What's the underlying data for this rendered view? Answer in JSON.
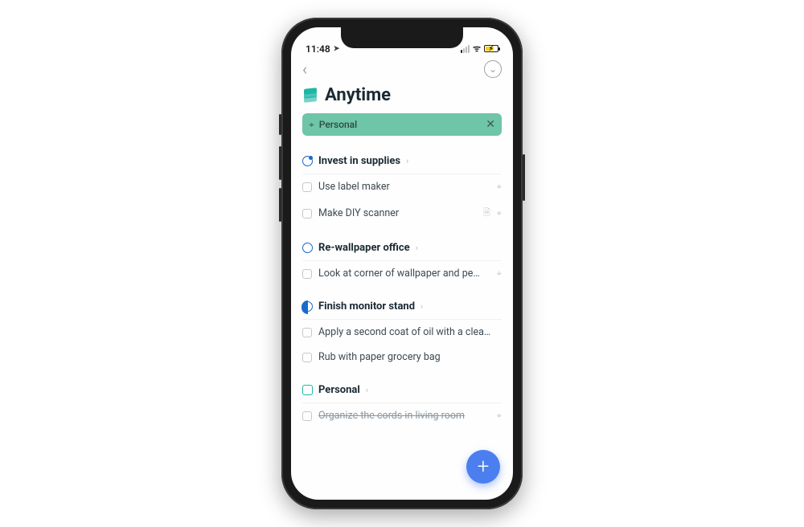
{
  "statusbar": {
    "time": "11:48"
  },
  "page": {
    "title": "Anytime"
  },
  "filter": {
    "label": "Personal"
  },
  "sections": [
    {
      "id": "invest",
      "title": "Invest in supplies",
      "tasks": [
        {
          "label": "Use label maker",
          "struck": false,
          "trailing": [
            "tag"
          ]
        },
        {
          "label": "Make DIY scanner",
          "struck": false,
          "trailing": [
            "note",
            "tag"
          ]
        }
      ]
    },
    {
      "id": "wallpaper",
      "title": "Re-wallpaper office",
      "tasks": [
        {
          "label": "Look at corner of wallpaper and pe…",
          "struck": false,
          "trailing": [
            "tag"
          ]
        }
      ]
    },
    {
      "id": "monitor",
      "title": "Finish monitor stand",
      "tasks": [
        {
          "label": "Apply a second coat of oil with a clea…",
          "struck": false,
          "trailing": []
        },
        {
          "label": "Rub with paper grocery bag",
          "struck": false,
          "trailing": []
        }
      ]
    },
    {
      "id": "personal",
      "title": "Personal",
      "tasks": [
        {
          "label": "Organize the cords in living room",
          "struck": true,
          "trailing": [
            "tag"
          ]
        }
      ]
    }
  ],
  "fab": {
    "glyph": "+"
  }
}
